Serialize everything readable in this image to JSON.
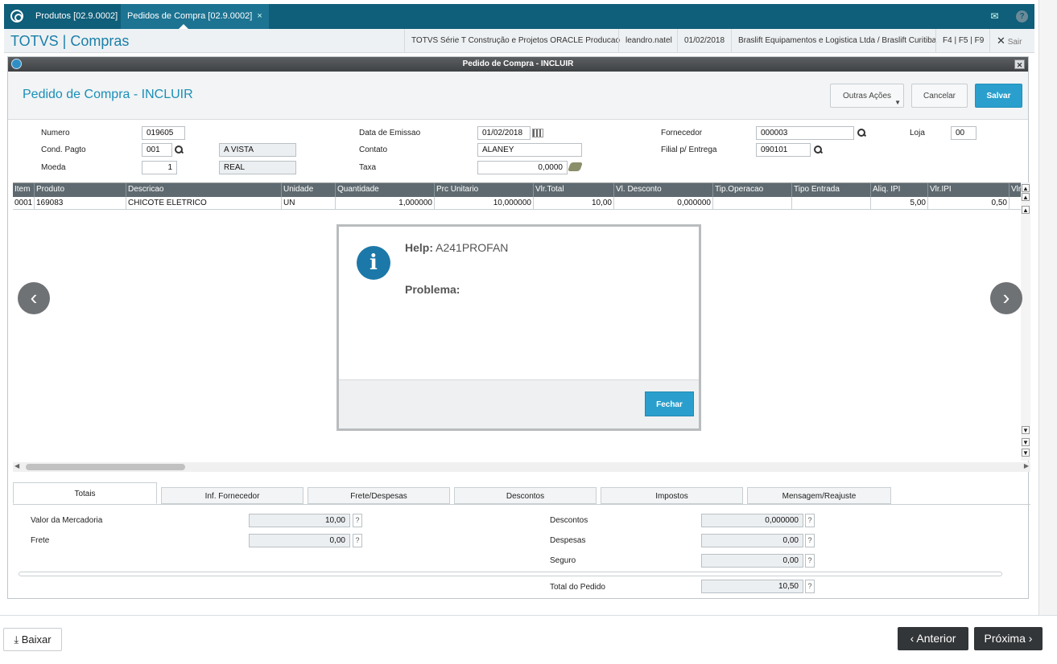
{
  "tabs": [
    {
      "label": "Produtos [02.9.0002]",
      "close": "×"
    },
    {
      "label": "Pedidos de Compra [02.9.0002]",
      "close": "×"
    }
  ],
  "header": {
    "brand": "TOTVS | Compras",
    "environment": "TOTVS Série T Construção e Projetos ORACLE Producao",
    "user": "leandro.natel",
    "date": "01/02/2018",
    "company": "Braslift Equipamentos e Logistica Ltda / Braslift Curitiba",
    "shortcuts": "F4 | F5 | F9",
    "exit_label": "Sair"
  },
  "window": {
    "title": "Pedido de Compra - INCLUIR",
    "page_title": "Pedido de Compra - INCLUIR",
    "actions": {
      "other": "Outras Ações",
      "cancel": "Cancelar",
      "save": "Salvar"
    }
  },
  "form": {
    "numero": {
      "label": "Numero",
      "value": "019605"
    },
    "cond_pagto": {
      "label": "Cond. Pagto",
      "value": "001",
      "desc": "A VISTA"
    },
    "moeda": {
      "label": "Moeda",
      "value": "1",
      "desc": "REAL"
    },
    "data_emissao": {
      "label": "Data de Emissao",
      "value": "01/02/2018"
    },
    "contato": {
      "label": "Contato",
      "value": "ALANEY"
    },
    "taxa": {
      "label": "Taxa",
      "value": "0,0000"
    },
    "fornecedor": {
      "label": "Fornecedor",
      "value": "000003"
    },
    "loja": {
      "label": "Loja",
      "value": "00"
    },
    "filial": {
      "label": "Filial p/ Entrega",
      "value": "090101"
    }
  },
  "grid": {
    "columns": [
      "Item",
      "Produto",
      "Descricao",
      "Unidade",
      "Quantidade",
      "Prc Unitario",
      "Vlr.Total",
      "Vl. Desconto",
      "Tip.Operacao",
      "Tipo Entrada",
      "Aliq. IPI",
      "Vlr.IPI",
      "Vlr"
    ],
    "rows": [
      [
        "0001",
        "169083",
        "CHICOTE ELETRICO",
        "UN",
        "1,000000",
        "10,000000",
        "10,00",
        "0,000000",
        "",
        "",
        "5,00",
        "0,50"
      ]
    ]
  },
  "help": {
    "help_label": "Help:",
    "help_code": "A241PROFAN",
    "problem_label": "Problema:",
    "close_label": "Fechar"
  },
  "bottom_tabs": [
    "Totais",
    "Inf. Fornecedor",
    "Frete/Despesas",
    "Descontos",
    "Impostos",
    "Mensagem/Reajuste"
  ],
  "totals": {
    "valor_mercadoria": {
      "label": "Valor da Mercadoria",
      "value": "10,00"
    },
    "frete": {
      "label": "Frete",
      "value": "0,00"
    },
    "descontos": {
      "label": "Descontos",
      "value": "0,000000"
    },
    "despesas": {
      "label": "Despesas",
      "value": "0,00"
    },
    "seguro": {
      "label": "Seguro",
      "value": "0,00"
    },
    "total_pedido": {
      "label": "Total do Pedido",
      "value": "10,50"
    },
    "help_mark": "?"
  },
  "footer": {
    "download": "Baixar",
    "previous": "Anterior",
    "next": "Próxima"
  },
  "colors": {
    "accent": "#2a9fcd",
    "topbar": "#0f5e7a",
    "grid_header": "#5e6a70"
  }
}
